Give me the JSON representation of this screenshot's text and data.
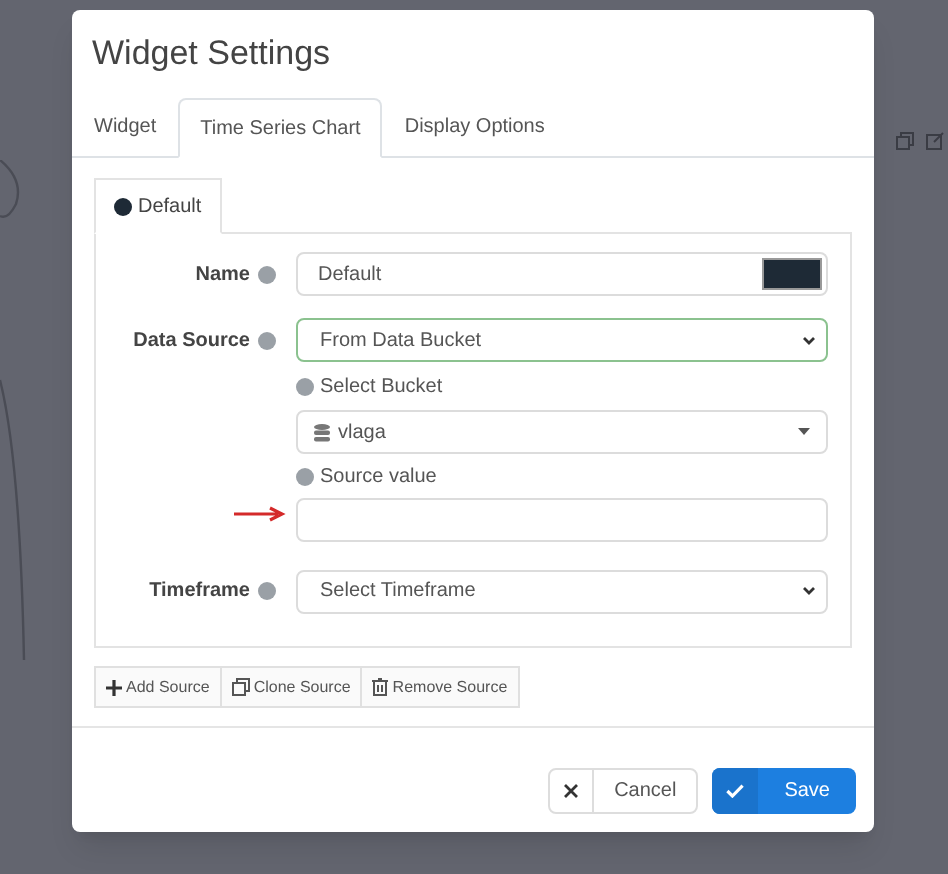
{
  "dialog": {
    "title": "Widget Settings"
  },
  "tabs": [
    {
      "label": "Widget",
      "selected": false
    },
    {
      "label": "Time Series Chart",
      "selected": true
    },
    {
      "label": "Display Options",
      "selected": false
    }
  ],
  "source_tabs": [
    {
      "label": "Default",
      "selected": true,
      "color": "#1e2a36"
    }
  ],
  "form": {
    "name": {
      "label": "Name",
      "value": "Default",
      "color": "#1e2a36"
    },
    "data_source": {
      "label": "Data Source",
      "value": "From Data Bucket"
    },
    "select_bucket": {
      "label": "Select Bucket",
      "value": "vlaga"
    },
    "source_value": {
      "label": "Source value"
    },
    "timeframe": {
      "label": "Timeframe",
      "value": "Select Timeframe"
    }
  },
  "source_buttons": [
    "Add Source",
    "Clone Source",
    "Remove Source"
  ],
  "footer_buttons": [
    {
      "kind": "cancel",
      "label": "Cancel"
    },
    {
      "kind": "save",
      "label": "Save"
    }
  ]
}
